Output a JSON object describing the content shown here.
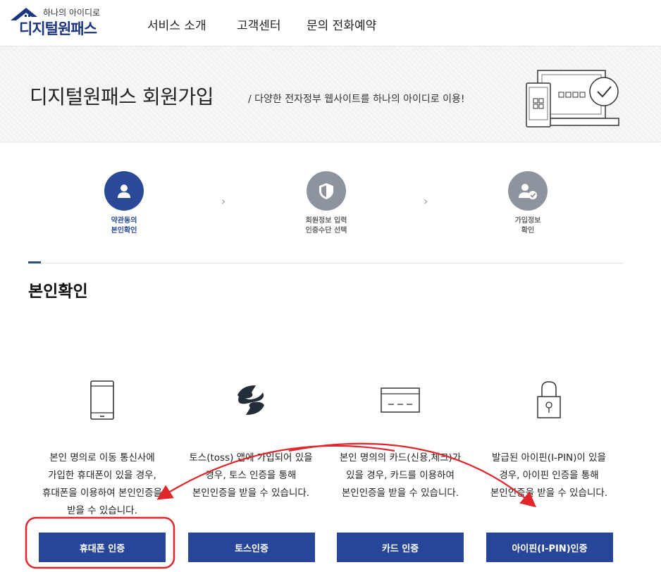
{
  "header": {
    "logo_tagline": "하나의 아이디로",
    "logo_name": "디지털원패스",
    "nav": [
      "서비스 소개",
      "고객센터",
      "문의 전화예약"
    ]
  },
  "banner": {
    "title": "디지털원패스 회원가입",
    "subtitle": "/ 다양한 전자정부 웹사이트를 하나의 아이디로 이용!"
  },
  "steps": [
    {
      "line1": "약관동의",
      "line2": "본인확인",
      "state": "active",
      "icon": "user-icon"
    },
    {
      "line1": "회원정보 입력",
      "line2": "인증수단 선택",
      "state": "inactive",
      "icon": "shield-icon"
    },
    {
      "line1": "가입정보",
      "line2": "확인",
      "state": "inactive",
      "icon": "user-check-icon"
    }
  ],
  "section": {
    "title": "본인확인"
  },
  "methods": [
    {
      "icon": "mobile-phone-icon",
      "desc": [
        "본인 명의로 이동 통신사에",
        "가입한 휴대폰이 있을 경우,",
        "휴대폰을 이용하여 본인인증을",
        "받을 수 있습니다."
      ],
      "button": "휴대폰 인증"
    },
    {
      "icon": "toss-logo-icon",
      "desc": [
        "토스(toss) 앱에 가입되어 있을",
        "경우, 토스 인증을 통해",
        "본인인증을 받을 수 있습니다."
      ],
      "button": "토스인증"
    },
    {
      "icon": "credit-card-icon",
      "desc": [
        "본인 명의의 카드(신용,체크)가",
        "있을 경우, 카드를 이용하여",
        "본인인증을 받을 수 있습니다."
      ],
      "button": "카드 인증"
    },
    {
      "icon": "padlock-icon",
      "desc": [
        "발급된 아이핀(I-PIN)이 있을",
        "경우, 아이핀 인증을 통해",
        "본인인증을 받을 수 있습니다."
      ],
      "button": "아이핀(I-PIN)인증"
    }
  ],
  "colors": {
    "primary": "#27469a",
    "step_inactive": "#8e949e",
    "annotation": "#e0262b"
  }
}
